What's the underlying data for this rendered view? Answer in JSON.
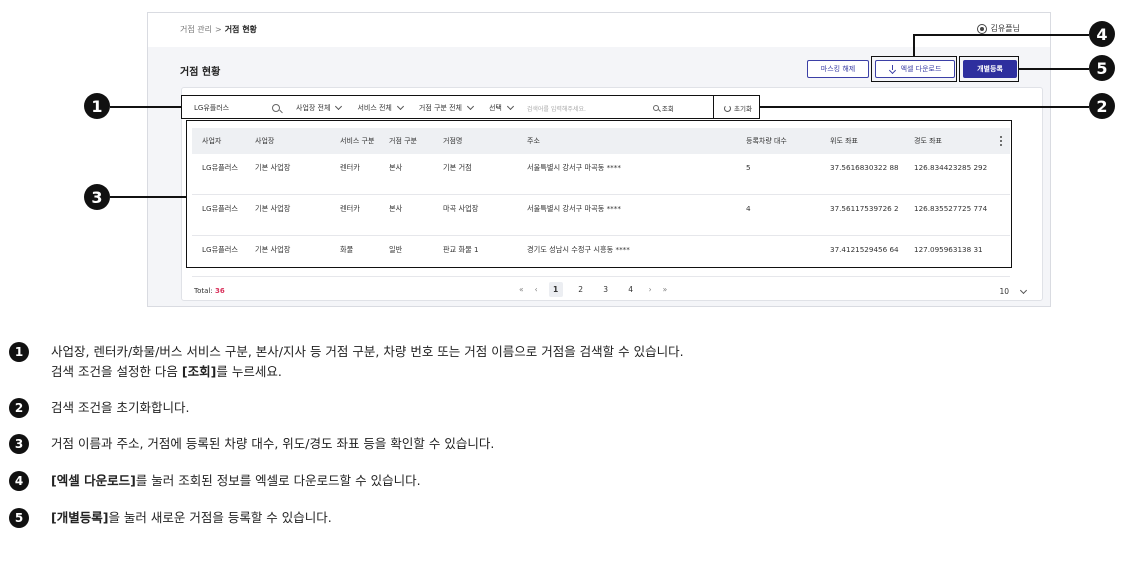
{
  "breadcrumb": {
    "parent": "거점 관리",
    "separator": ">",
    "current": "거점 현황"
  },
  "user": {
    "name": "김유플님",
    "icon": "user-circle-icon"
  },
  "page_title": "거점 현황",
  "toolbar": {
    "mask_label": "마스킹 해제",
    "excel_label": "엑셀 다운로드",
    "excel_icon": "download-icon",
    "add_label": "개별등록"
  },
  "filters": {
    "business_value": "LG유플러스",
    "site_select": "사업장 전체",
    "service_select": "서비스 전체",
    "hub_type_select": "거점 구분 전체",
    "condition_select": "선택",
    "keyword_placeholder": "검색어를 입력해주세요.",
    "search_label": "조회",
    "reset_label": "초기화"
  },
  "table": {
    "headers": [
      "사업자",
      "사업장",
      "서비스 구분",
      "거점 구분",
      "거점명",
      "주소",
      "등록차량 대수",
      "위도 좌표",
      "경도 좌표"
    ],
    "rows": [
      [
        "LG유플러스",
        "기본 사업장",
        "렌터카",
        "본사",
        "기본 거점",
        "서울특별시 강서구 마곡동 ****",
        "5",
        "37.5616830322 88",
        "126.834423285 292"
      ],
      [
        "LG유플러스",
        "기본 사업장",
        "렌터카",
        "본사",
        "마곡 사업장",
        "서울특별시 강서구 마곡동 ****",
        "4",
        "37.56117539726 2",
        "126.835527725 774"
      ],
      [
        "LG유플러스",
        "기본 사업장",
        "화물",
        "일반",
        "판교 화물 1",
        "경기도 성남시 수정구 시흥동 ****",
        "",
        "37.4121529456 64",
        "127.095963138 31"
      ]
    ]
  },
  "footer": {
    "total_label": "Total:",
    "total_count": "36",
    "pages": [
      "1",
      "2",
      "3",
      "4"
    ],
    "current_page": "1",
    "nav_first": "«",
    "nav_prev": "‹",
    "nav_next": "›",
    "nav_last": "»",
    "page_size": "10"
  },
  "markers": [
    "1",
    "2",
    "3",
    "4",
    "5"
  ],
  "descriptions": {
    "d1_line1": "사업장, 렌터카/화물/버스 서비스 구분, 본사/지사 등 거점 구분, 차량 번호 또는 거점 이름으로 거점을 검색할 수 있습니다.",
    "d1_line2_pre": "검색 조건을 설정한 다음 ",
    "d1_line2_bold": "[조회]",
    "d1_line2_post": "를 누르세요.",
    "d2": "검색 조건을 초기화합니다.",
    "d3": "거점 이름과 주소, 거점에 등록된 차량 대수, 위도/경도 좌표 등을 확인할 수 있습니다.",
    "d4_bold": "[엑셀 다운로드]",
    "d4_post": "를 눌러 조회된 정보를 엑셀로 다운로드할 수 있습니다.",
    "d5_bold": "[개별등록]",
    "d5_post": "을 눌러 새로운 거점을 등록할 수 있습니다."
  }
}
